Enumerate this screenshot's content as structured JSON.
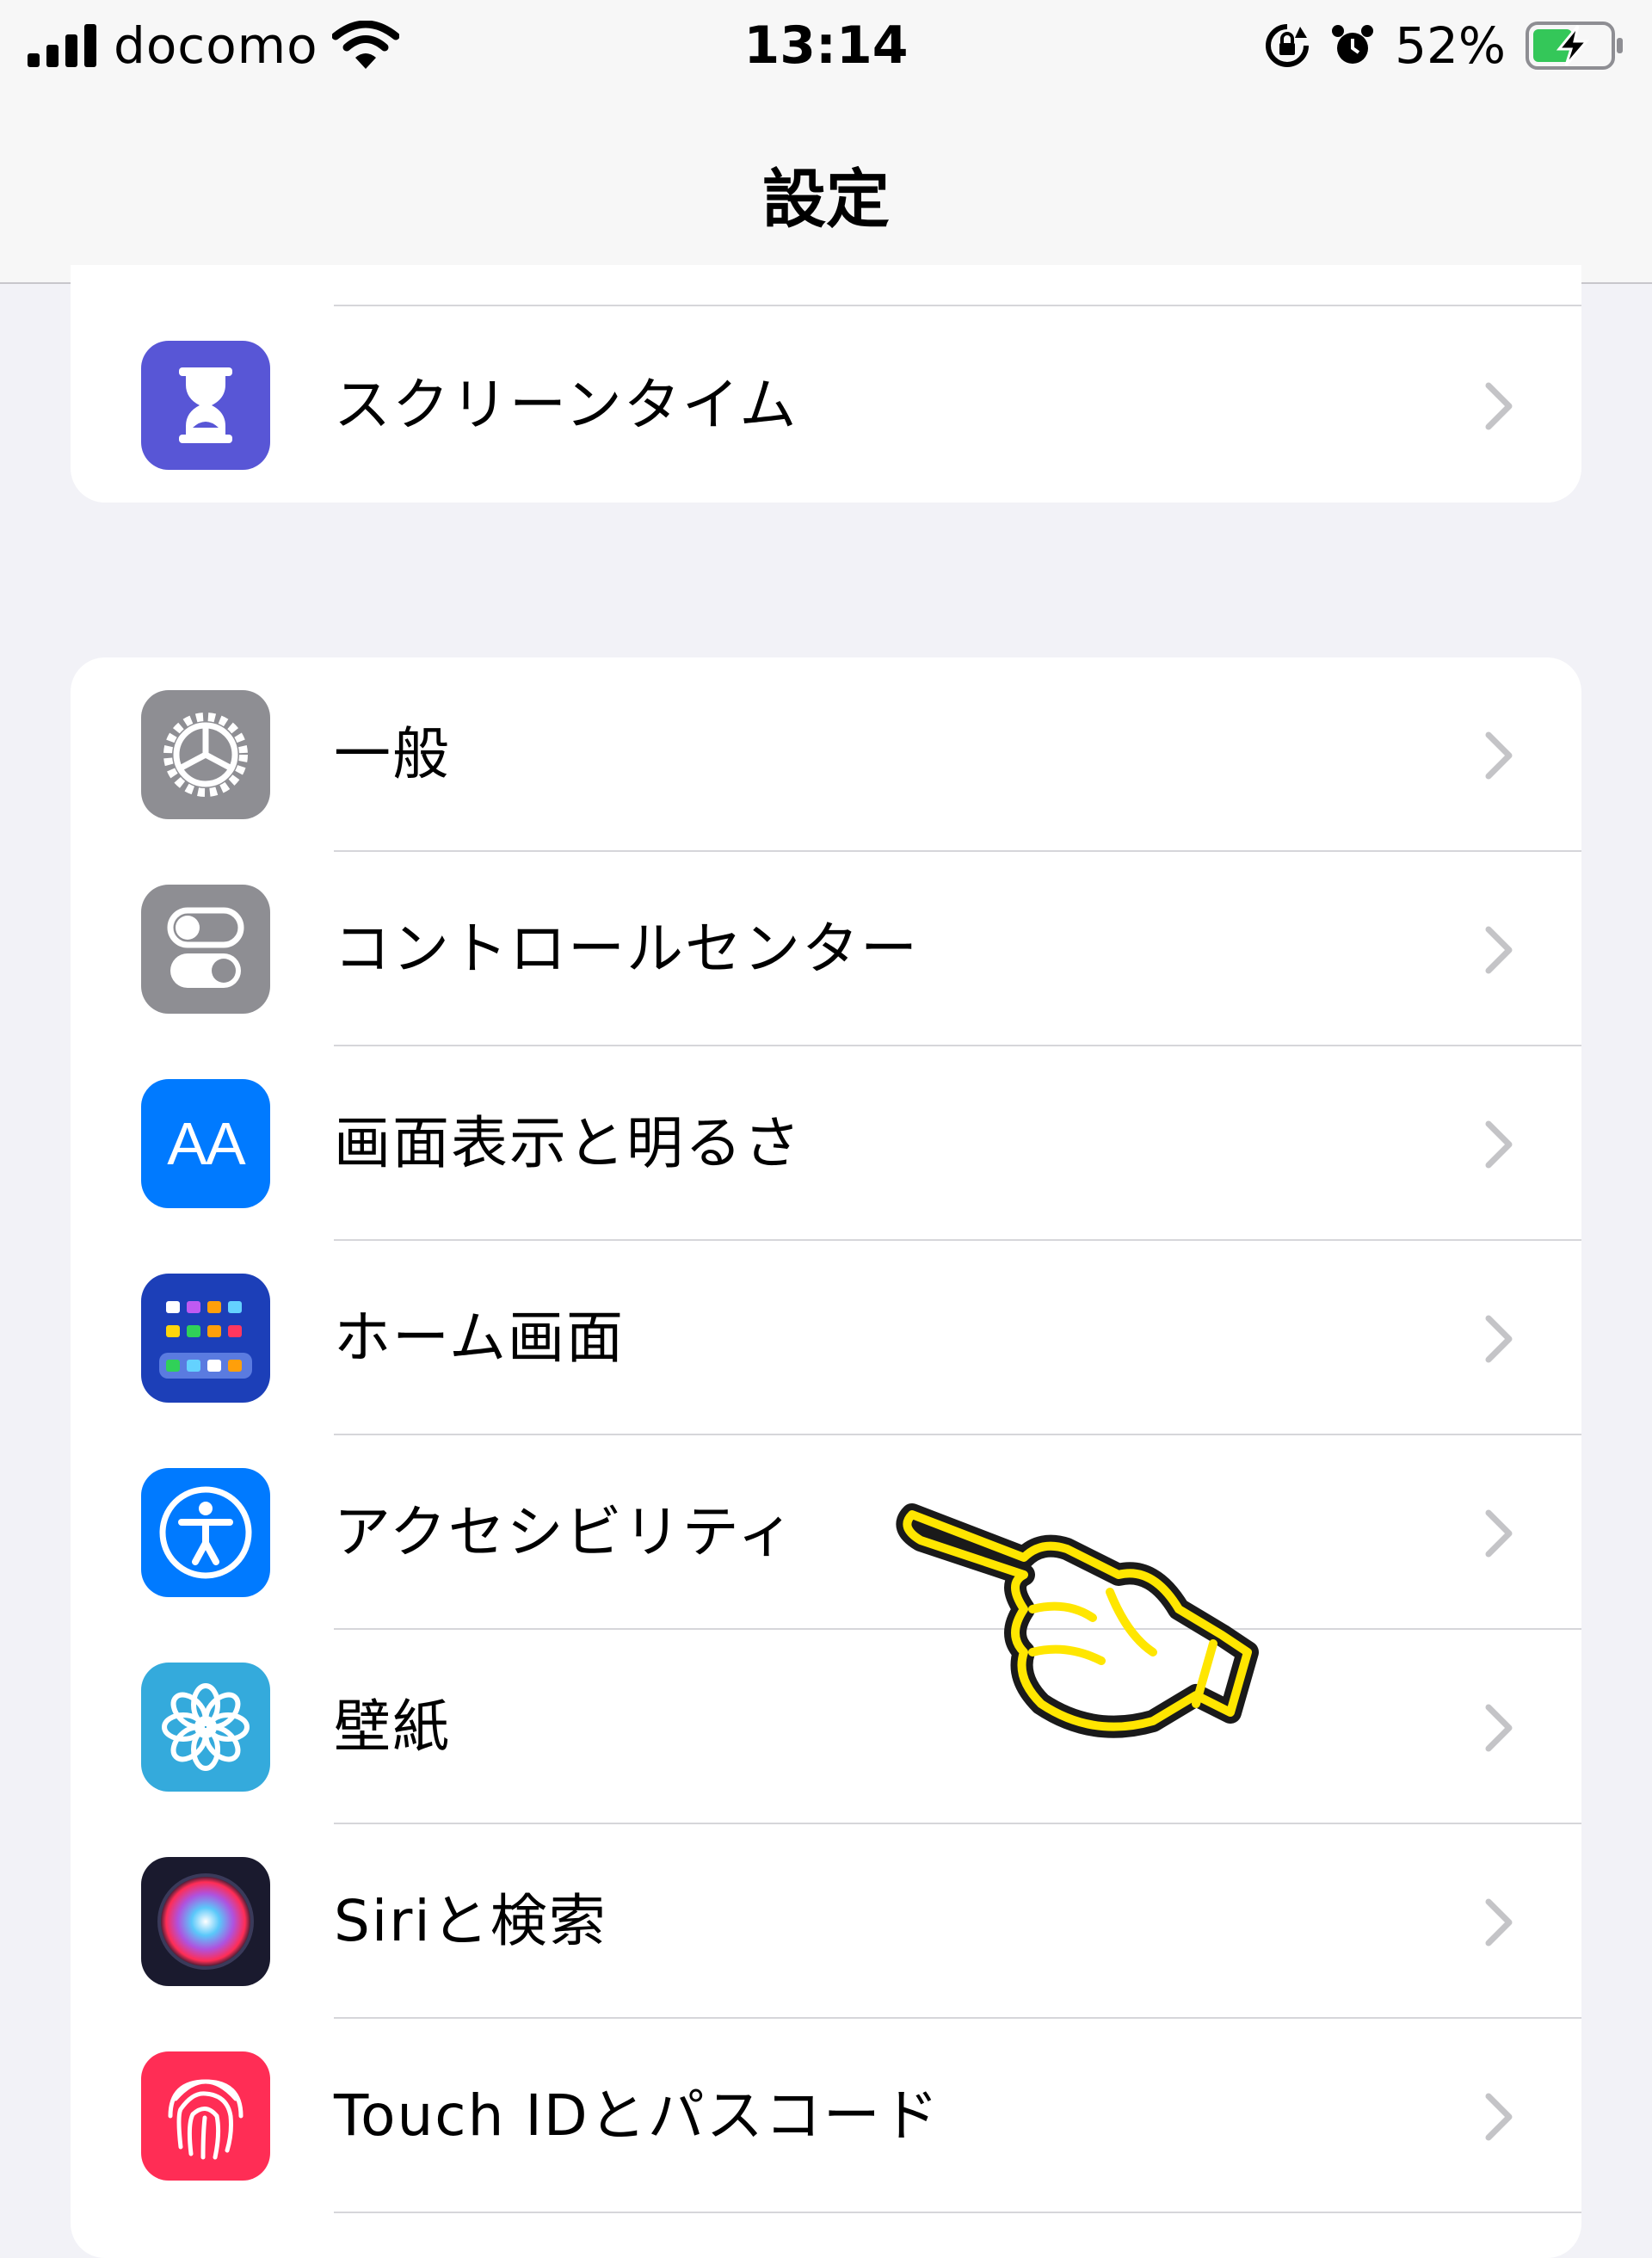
{
  "status_bar": {
    "carrier": "docomo",
    "time": "13:14",
    "battery": "52%",
    "battery_level": 0.52,
    "icons": [
      "signal-icon",
      "wifi-icon",
      "orientation-lock-icon",
      "alarm-icon",
      "battery-charging-icon"
    ]
  },
  "nav": {
    "title": "設定"
  },
  "groups": [
    {
      "items": [
        {
          "label": "スクリーンタイム",
          "icon": "hourglass-icon",
          "color": "#5856d6"
        }
      ]
    },
    {
      "items": [
        {
          "label": "一般",
          "icon": "gear-icon",
          "color": "#8e8e93"
        },
        {
          "label": "コントロールセンター",
          "icon": "toggles-icon",
          "color": "#8e8e93"
        },
        {
          "label": "画面表示と明るさ",
          "icon": "text-size-icon",
          "icon_text": "AA",
          "color": "#007aff"
        },
        {
          "label": "ホーム画面",
          "icon": "home-screen-grid-icon",
          "color": "#1c3fb8"
        },
        {
          "label": "アクセシビリティ",
          "icon": "accessibility-icon",
          "color": "#007aff"
        },
        {
          "label": "壁紙",
          "icon": "flower-icon",
          "color": "#34aadc"
        },
        {
          "label": "Siriと検索",
          "icon": "siri-icon",
          "color": "#1a1a2e"
        },
        {
          "label": "Touch IDとパスコード",
          "icon": "fingerprint-icon",
          "color": "#ff2d55"
        }
      ]
    }
  ],
  "overlay": {
    "icon": "pointing-hand-icon",
    "color": "#ffe600"
  }
}
